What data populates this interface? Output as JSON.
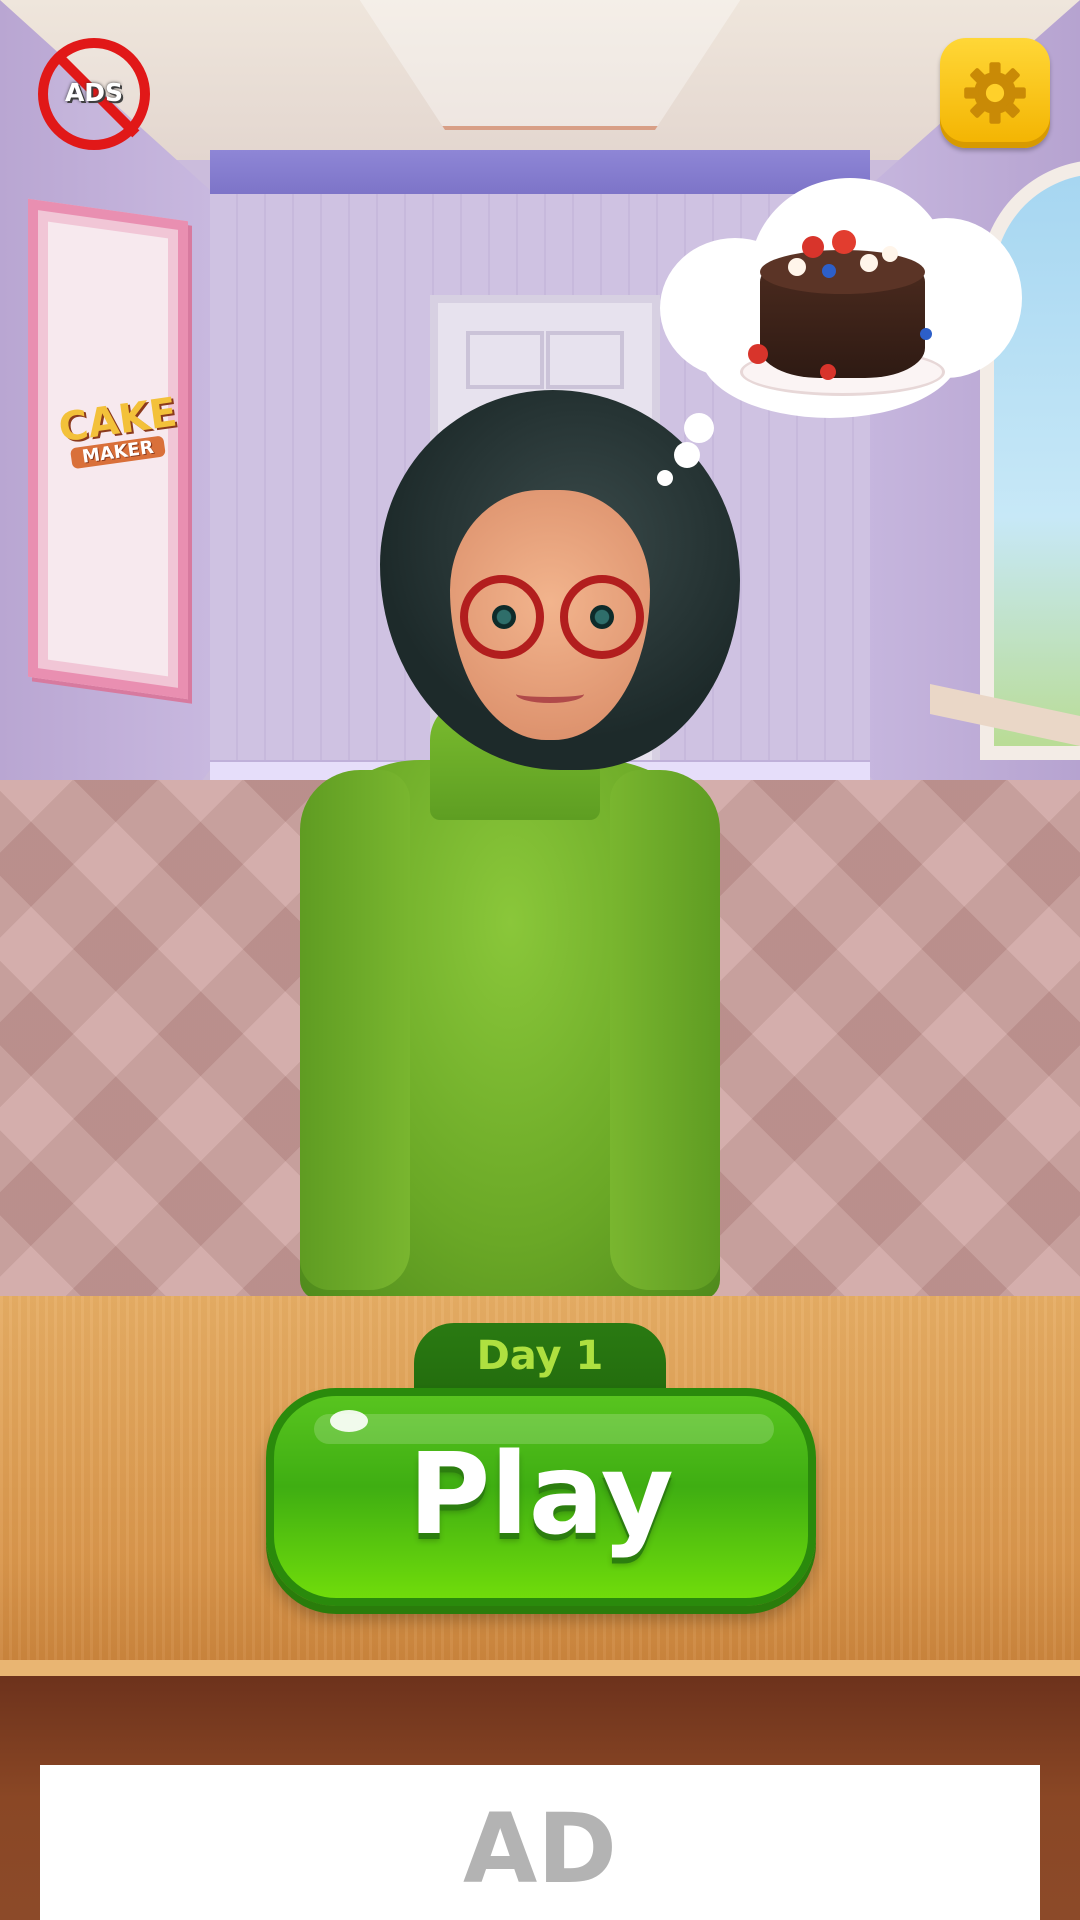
{
  "top_bar": {
    "no_ads_label": "ADS",
    "settings_icon": "gear-icon"
  },
  "scene": {
    "poster": {
      "line1": "CAKE",
      "line2": "MAKER"
    },
    "thought": "cake-icon"
  },
  "play_area": {
    "day_label": "Day 1",
    "play_label": "Play"
  },
  "ad": {
    "label": "AD"
  },
  "colors": {
    "play_green": "#4fbf13",
    "settings_yellow": "#ffc718",
    "no_ads_red": "#e11818",
    "day_text": "#aee040"
  }
}
